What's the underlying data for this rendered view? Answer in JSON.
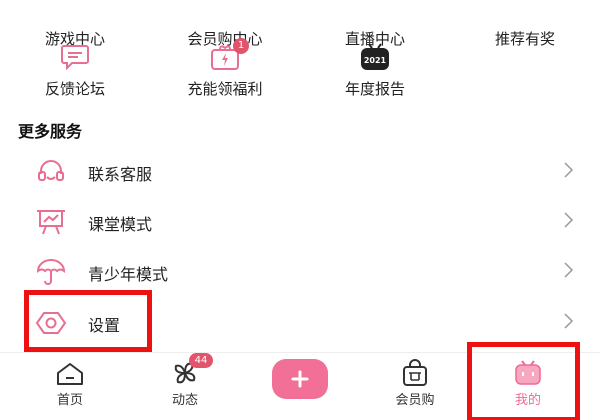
{
  "services_grid": {
    "row1": [
      {
        "label": "游戏中心",
        "icon": "game-center-icon"
      },
      {
        "label": "会员购中心",
        "icon": "vip-shop-center-icon"
      },
      {
        "label": "直播中心",
        "icon": "live-center-icon"
      },
      {
        "label": "推荐有奖",
        "icon": "referral-reward-icon"
      }
    ],
    "row2": [
      {
        "label": "反馈论坛",
        "icon": "feedback-forum-icon"
      },
      {
        "label": "充能领福利",
        "icon": "charge-benefit-icon",
        "badge": "1"
      },
      {
        "label": "年度报告",
        "icon": "annual-report-icon",
        "icon_text": "2021"
      }
    ]
  },
  "more_services": {
    "title": "更多服务",
    "items": [
      {
        "label": "联系客服",
        "icon": "headset-icon"
      },
      {
        "label": "课堂模式",
        "icon": "classroom-icon"
      },
      {
        "label": "青少年模式",
        "icon": "umbrella-icon"
      },
      {
        "label": "设置",
        "icon": "settings-icon"
      }
    ]
  },
  "tabbar": {
    "home": "首页",
    "feed": "动态",
    "feed_badge": "44",
    "add": "+",
    "vip": "会员购",
    "mine": "我的"
  },
  "colors": {
    "accent": "#f26f97",
    "icon_stroke": "#e86f92",
    "badge": "#e2536c",
    "highlight": "#ee1111"
  }
}
